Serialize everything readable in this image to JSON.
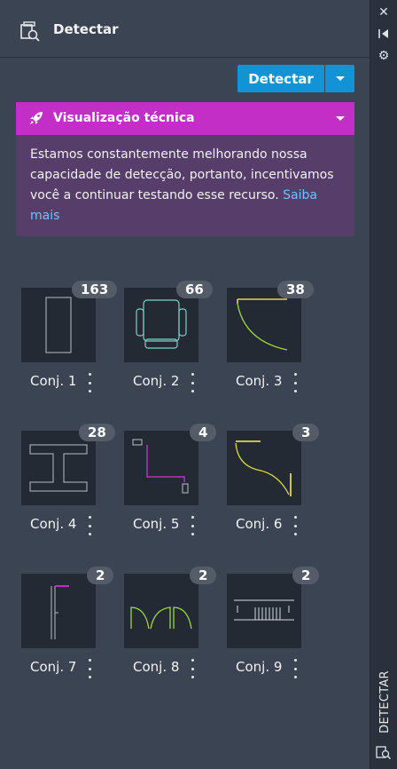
{
  "header": {
    "title": "Detectar",
    "icon": "detect-icon"
  },
  "actions": {
    "detect_label": "Detectar",
    "dropdown_icon": "caret-down-icon"
  },
  "banner": {
    "title": "Visualização técnica",
    "icon": "rocket-icon",
    "body": "Estamos constantemente melhorando nossa capacidade de detecção, portanto, incentivamos você a continuar testando esse recurso.",
    "link": "Saiba mais",
    "colors": {
      "header": "#c22ec6",
      "body": "#573e6a",
      "link": "#6fc2ff"
    }
  },
  "sets": [
    {
      "label": "Conj. 1",
      "count": "163"
    },
    {
      "label": "Conj. 2",
      "count": "66"
    },
    {
      "label": "Conj. 3",
      "count": "38"
    },
    {
      "label": "Conj. 4",
      "count": "28"
    },
    {
      "label": "Conj. 5",
      "count": "4"
    },
    {
      "label": "Conj. 6",
      "count": "3"
    },
    {
      "label": "Conj. 7",
      "count": "2"
    },
    {
      "label": "Conj. 8",
      "count": "2"
    },
    {
      "label": "Conj. 9",
      "count": "2"
    }
  ],
  "side": {
    "tab_label": "DETECTAR",
    "icons": [
      "close-icon",
      "collapse-icon",
      "settings-icon"
    ]
  },
  "colors": {
    "panel": "#3b4453",
    "accent": "#1293d8",
    "thumb_bg": "#232a34"
  }
}
